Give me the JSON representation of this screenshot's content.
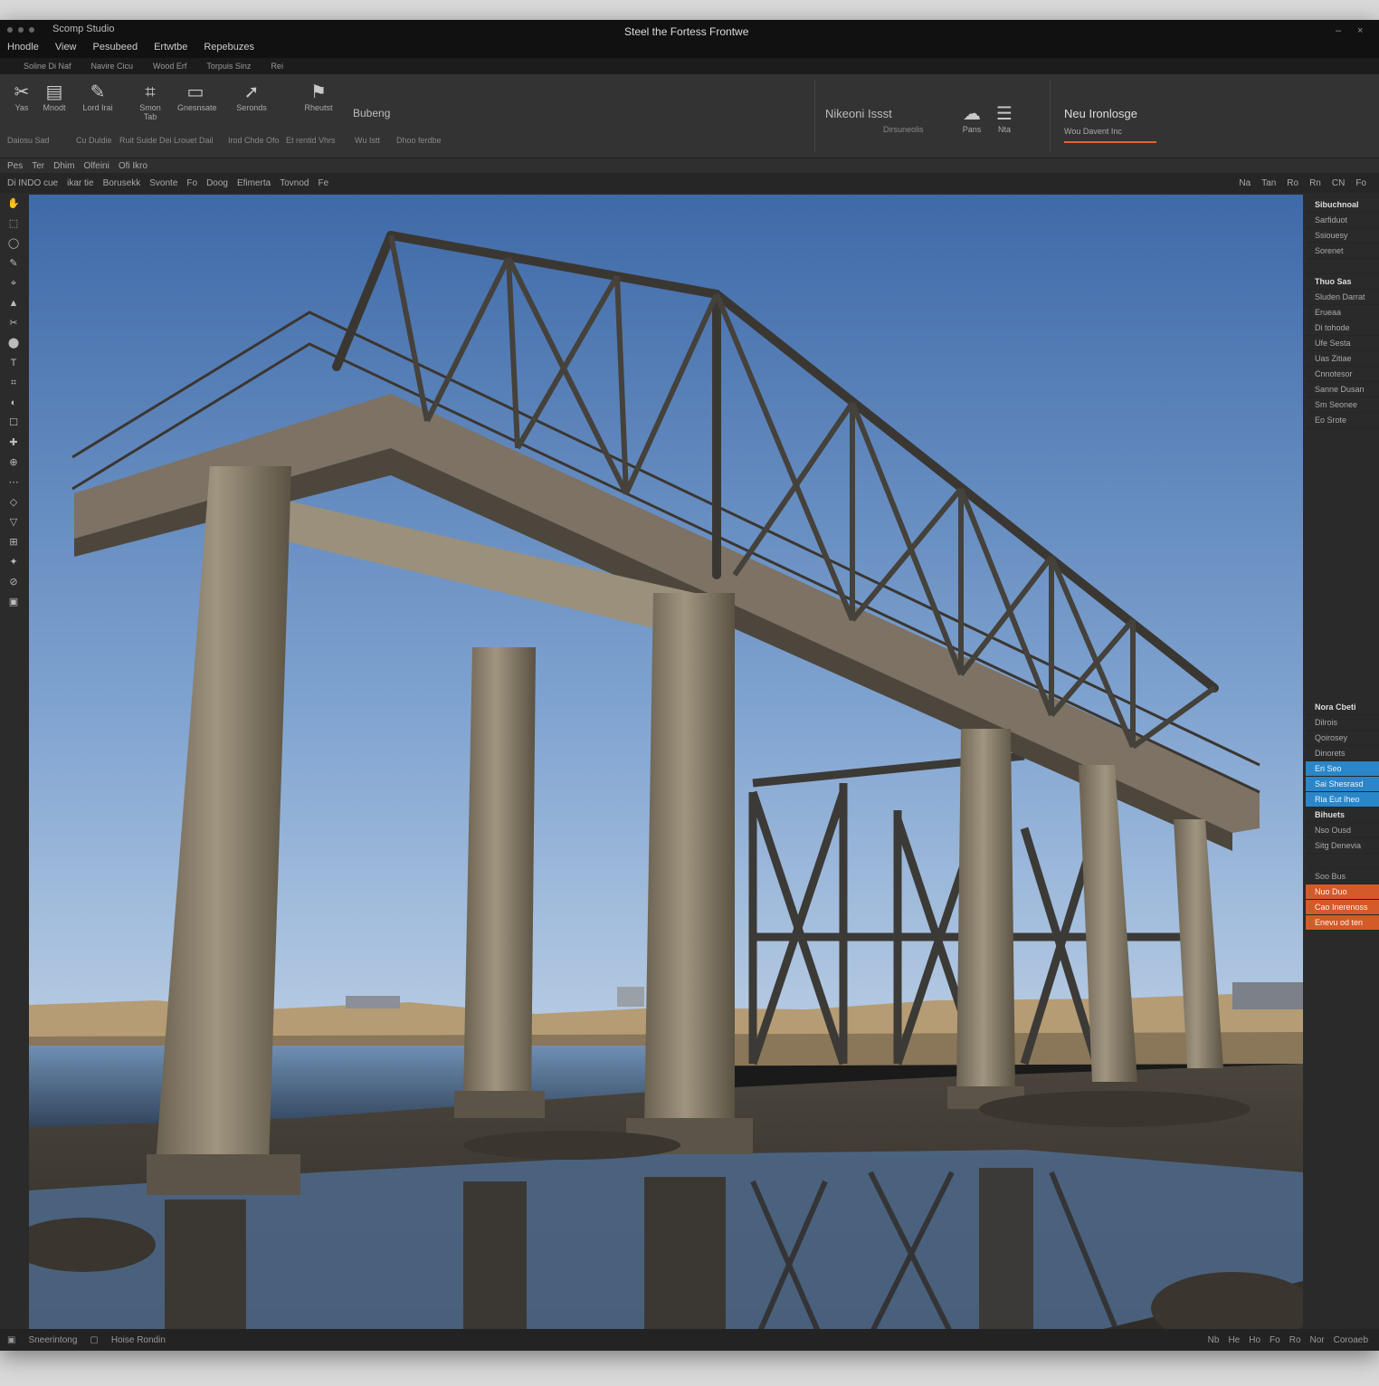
{
  "titlebar": {
    "app_title": "Scomp Studio",
    "doc_title": "Steel the Fortess Frontwe",
    "controls": [
      "–",
      "×"
    ]
  },
  "menu": [
    "Hnodle",
    "View",
    "Pesubeed",
    "Ertwtbe",
    "Repebuzes"
  ],
  "submenu": [
    "Soline Di  Naf",
    "Navire Cicu",
    "Wood Erf",
    "Torpuis  Sinz",
    "Rei"
  ],
  "ribbon": {
    "tools": [
      {
        "icon": "scissors-icon",
        "glyph": "✂",
        "label": "Yas"
      },
      {
        "icon": "layers-icon",
        "glyph": "▤",
        "label": "Mnodt"
      },
      {
        "icon": "brush-icon",
        "glyph": "✎",
        "label": "Lord Irai"
      },
      {
        "icon": "crop-icon",
        "glyph": "⌗",
        "label": "Smon Tab"
      },
      {
        "icon": "monitor-icon",
        "glyph": "▭",
        "label": "Gnesnsate"
      },
      {
        "icon": "cursor-icon",
        "glyph": "➚",
        "label": "Seronds"
      },
      {
        "icon": "flag-icon",
        "glyph": "⚑",
        "label": "Rheutst"
      }
    ],
    "group_label": "Bubeng",
    "captions": [
      "Daiosu Sad",
      "Cu Duldie",
      "Ruit Suide Dei Lrouet Dail",
      "Irod Chde Ofo",
      "Et rentid Vhrs",
      "Wu Istt",
      "Dhoo ferdbe"
    ],
    "right_group_title": "Nikeoni Issst",
    "right_group_caption": "Dirsuneolis",
    "icon_captions": [
      "Pans",
      "Nta"
    ],
    "highlight_title": "Neu Ironlosge",
    "highlight_caption": "Wou  Davent Inc"
  },
  "optbar1": [
    "Pes",
    "Ter",
    "Dhim",
    "Olfeini",
    "Ofi Ikro"
  ],
  "optbar2": {
    "items": [
      "Di  INDO cue",
      "ikar tie",
      "Borusekk",
      "Svonte",
      "Fo",
      "Doog",
      "Efimerta",
      "Tovnod",
      "Fe"
    ],
    "right": [
      "Na",
      "Tan",
      "Ro",
      "Rn",
      "CN",
      "Fo"
    ]
  },
  "left_tools": [
    "✋",
    "⬚",
    "◯",
    "✎",
    "⌖",
    "▲",
    "✂",
    "⬤",
    "T",
    "⌗",
    "◐",
    "☐",
    "✚",
    "⊕",
    "⋯",
    "◇",
    "▽",
    "⊞",
    "✦",
    "⊘",
    "▣"
  ],
  "panel": {
    "rows": [
      {
        "text": "Sibuchnoal",
        "style": "hdr"
      },
      {
        "text": "Sarfiduot",
        "style": ""
      },
      {
        "text": "Ssiouesy",
        "style": ""
      },
      {
        "text": "Sorenet",
        "style": ""
      },
      {
        "text": "",
        "style": ""
      },
      {
        "text": "Thuo Sas",
        "style": "hdr"
      },
      {
        "text": "Sluden Darrat",
        "style": ""
      },
      {
        "text": "Erueaa",
        "style": ""
      },
      {
        "text": "Di tohode",
        "style": ""
      },
      {
        "text": "Ufe Sesta",
        "style": ""
      },
      {
        "text": "Uas  Zitiae",
        "style": ""
      },
      {
        "text": "Cnnotesor",
        "style": ""
      },
      {
        "text": "Sanne Dusan",
        "style": ""
      },
      {
        "text": "Sm Seonee",
        "style": ""
      },
      {
        "text": "Eo Srote",
        "style": ""
      }
    ],
    "rows2": [
      {
        "text": "Nora Cbeti",
        "style": "hdr"
      },
      {
        "text": "Dilrois",
        "style": ""
      },
      {
        "text": "Qoirosey",
        "style": ""
      },
      {
        "text": "Dinorets",
        "style": ""
      },
      {
        "text": "Eri Seo",
        "style": "sel-blue"
      },
      {
        "text": "Sai Shesrasd",
        "style": "sel-blue"
      },
      {
        "text": "Ria Eut Iheo",
        "style": "sel-blue"
      },
      {
        "text": "Bihuets",
        "style": "hdr"
      },
      {
        "text": "Nso Ousd",
        "style": ""
      },
      {
        "text": "Sitg Denevia",
        "style": ""
      },
      {
        "text": "",
        "style": ""
      },
      {
        "text": "Soo Bus",
        "style": ""
      },
      {
        "text": "Nuo Duo",
        "style": "sel-orange"
      },
      {
        "text": "Cao Inerenoss",
        "style": "sel-orange"
      },
      {
        "text": "Enevu od ten",
        "style": "sel-orange"
      }
    ]
  },
  "status": {
    "left": [
      "Sneerintong",
      "Hoise Rondin"
    ],
    "right": [
      "Nb",
      "He",
      "Ho",
      "Fo",
      "Ro",
      "Nor",
      "Coroaeb"
    ]
  },
  "colors": {
    "accent_orange": "#e0643a",
    "accent_blue": "#2a86c8",
    "sky_top": "#3f6aa8",
    "sky_bottom": "#a9c4e3"
  }
}
